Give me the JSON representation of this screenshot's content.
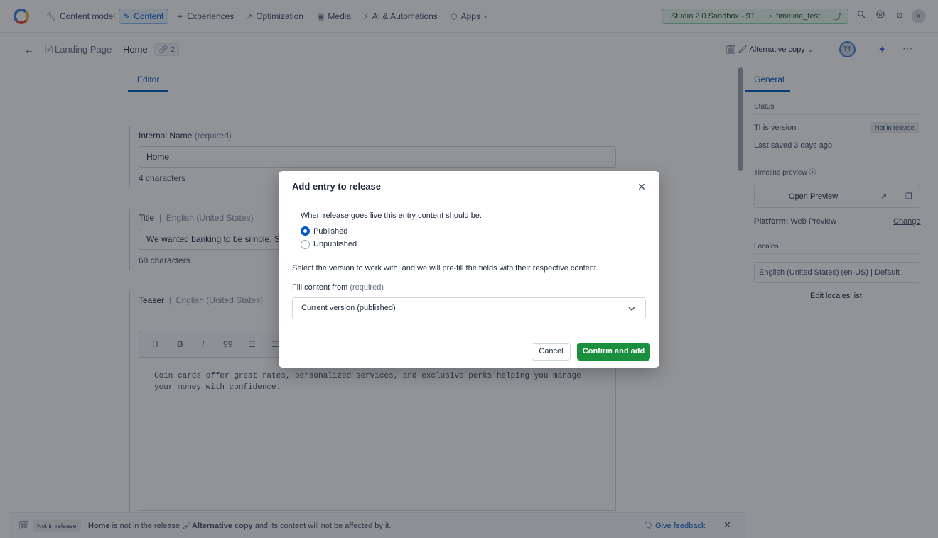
{
  "topnav": {
    "items": [
      {
        "label": "Content model",
        "icon": "wrench-icon"
      },
      {
        "label": "Content",
        "icon": "pencil-icon"
      },
      {
        "label": "Experiences",
        "icon": "brush-icon"
      },
      {
        "label": "Optimization",
        "icon": "trend-icon"
      },
      {
        "label": "Media",
        "icon": "image-icon"
      },
      {
        "label": "AI & Automations",
        "icon": "lightning-icon"
      },
      {
        "label": "Apps",
        "icon": "apps-icon"
      }
    ],
    "environment": {
      "space": "Studio 2.0 Sandbox - 9T ...",
      "env": "timeline_testi..."
    },
    "user_initials": "K"
  },
  "entry_header": {
    "content_type": "Landing Page",
    "entry_title": "Home",
    "reference_count": "2",
    "release_label": "Alternative copy",
    "avatar_initials": "TT"
  },
  "editor": {
    "tab_editor": "Editor",
    "fields": [
      {
        "name": "Internal Name",
        "required": "(required)",
        "value": "Home",
        "note": "4 characters"
      },
      {
        "name": "Title",
        "locale": "English (United States)",
        "value": "We wanted banking to be simple. So w",
        "note": "68 characters"
      },
      {
        "name": "Teaser",
        "locale": "English (United States)"
      }
    ],
    "rte_buttons": [
      "H",
      "B",
      "I",
      "99",
      "☰",
      "☰"
    ],
    "teaser_text": "Coin cards offer great rates, personalized services, and exclusive perks helping you manage your money with confidence."
  },
  "sidebar": {
    "tab_general": "General",
    "status_heading": "Status",
    "this_version": "This version",
    "not_in_release": "Not in release",
    "last_saved": "Last saved 3 days ago",
    "timeline_preview": "Timeline preview",
    "open_preview": "Open Preview",
    "platform_label": "Platform:",
    "platform_value": "Web Preview",
    "change": "Change",
    "locales_heading": "Locales",
    "locale_value": "English (United States) (en-US) | Default",
    "edit_locales": "Edit locales list"
  },
  "bottom_bar": {
    "pill": "Not in release",
    "entry": "Home",
    "text1": " is not in the release ",
    "release": "Alternative copy",
    "text2": " and its content will not be affected by it.",
    "feedback": "Give feedback"
  },
  "modal": {
    "title": "Add entry to release",
    "question": "When release goes live this entry content should be:",
    "option_published": "Published",
    "option_unpublished": "Unpublished",
    "selected_option": "Published",
    "instruction": "Select the version to work with, and we will pre-fill the fields with their respective content.",
    "fill_label": "Fill content from",
    "fill_required": "(required)",
    "fill_value": "Current version (published)",
    "cancel": "Cancel",
    "confirm": "Confirm and add"
  },
  "colors": {
    "primary_blue": "#0059c8",
    "confirm_green": "#1c8f3f",
    "env_green_bg": "#e9f7ee"
  }
}
